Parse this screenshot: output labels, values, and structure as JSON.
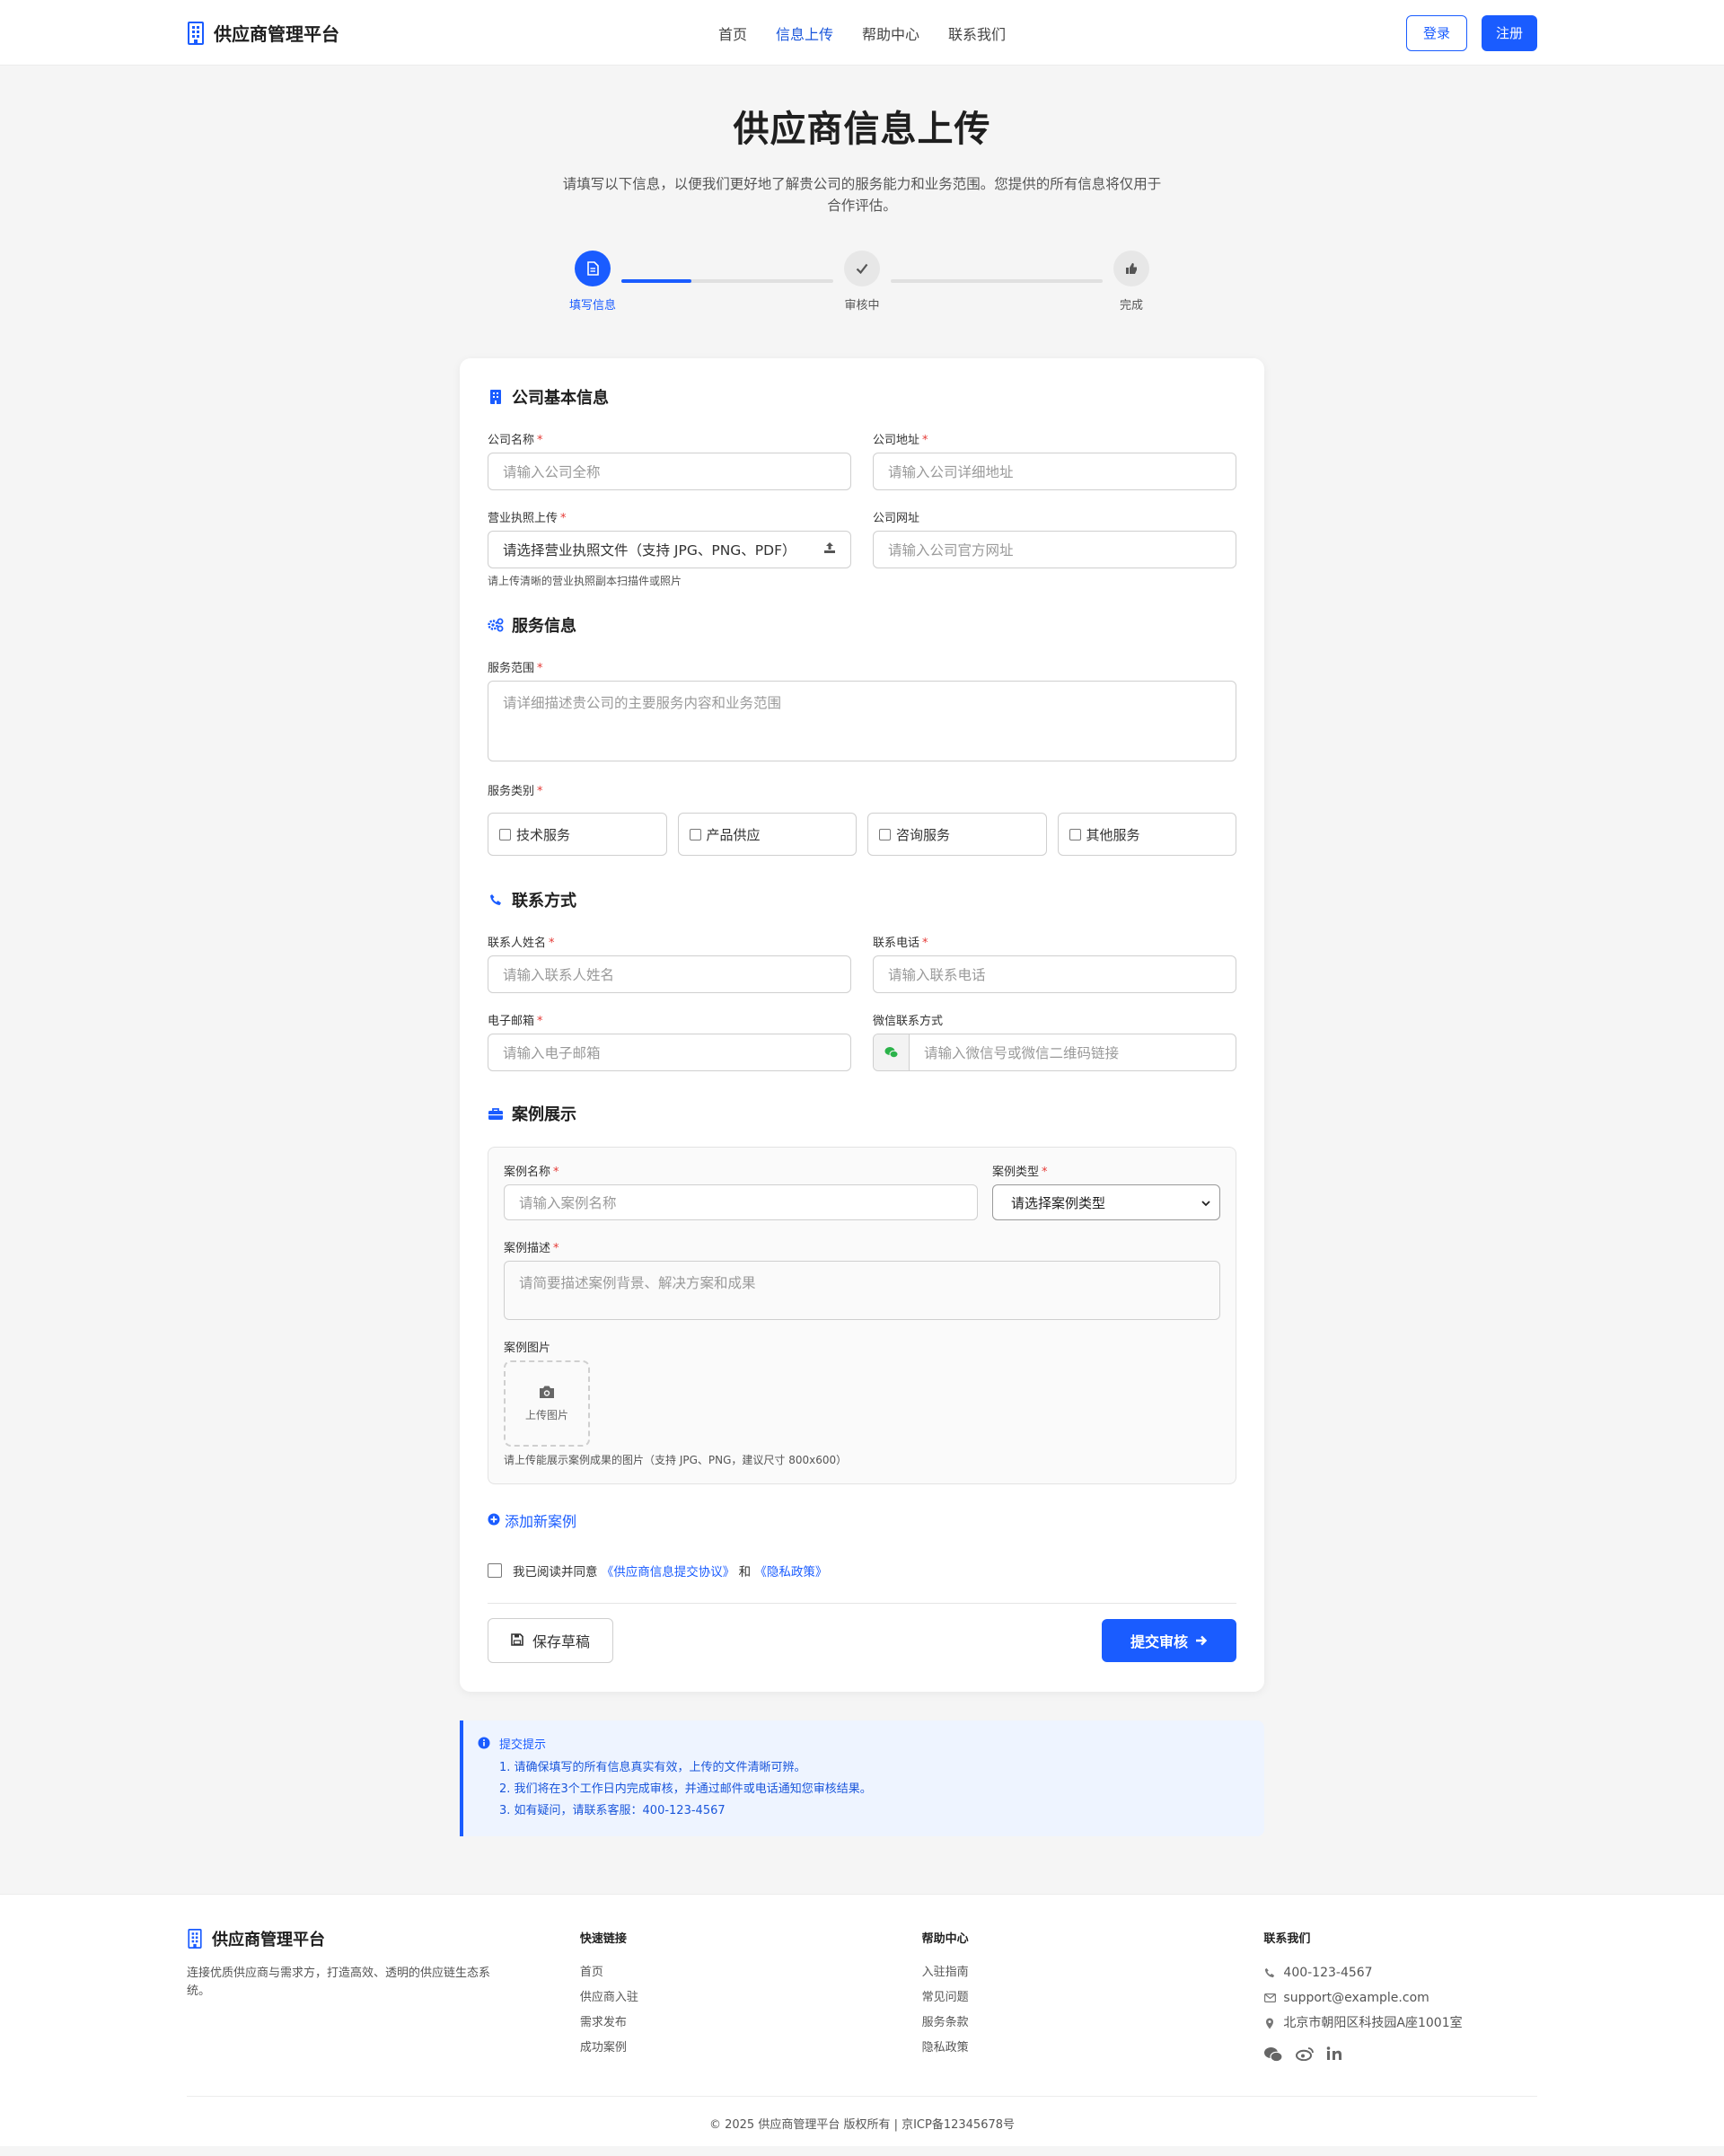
{
  "header": {
    "brand": "供应商管理平台",
    "nav": [
      "首页",
      "信息上传",
      "帮助中心",
      "联系我们"
    ],
    "nav_active_index": 1,
    "login_label": "登录",
    "register_label": "注册"
  },
  "hero": {
    "title": "供应商信息上传",
    "description": "请填写以下信息，以便我们更好地了解贵公司的服务能力和业务范围。您提供的所有信息将仅用于合作评估。"
  },
  "steps": {
    "items": [
      {
        "label": "填写信息",
        "icon": "document-icon",
        "state": "active"
      },
      {
        "label": "审核中",
        "icon": "check-icon",
        "state": "pending"
      },
      {
        "label": "完成",
        "icon": "thumbs-up-icon",
        "state": "pending"
      }
    ],
    "progress_first_segment": 0.33
  },
  "sections": {
    "basic": "公司基本信息",
    "service": "服务信息",
    "contact": "联系方式",
    "cases": "案例展示"
  },
  "basic_fields": {
    "company_name": {
      "label": "公司名称",
      "placeholder": "请输入公司全称",
      "required": "*"
    },
    "company_address": {
      "label": "公司地址",
      "placeholder": "请输入公司详细地址",
      "required": "*"
    },
    "license": {
      "label": "营业执照上传",
      "placeholder": "请选择营业执照文件（支持 JPG、PNG、PDF）",
      "required": "*",
      "help": "请上传清晰的营业执照副本扫描件或照片"
    },
    "website": {
      "label": "公司网址",
      "placeholder": "请输入公司官方网址"
    }
  },
  "service_fields": {
    "scope": {
      "label": "服务范围",
      "placeholder": "请详细描述贵公司的主要服务内容和业务范围",
      "required": "*"
    },
    "category": {
      "label": "服务类别",
      "required": "*",
      "options": [
        "技术服务",
        "产品供应",
        "咨询服务",
        "其他服务"
      ]
    }
  },
  "contact_fields": {
    "contact_name": {
      "label": "联系人姓名",
      "placeholder": "请输入联系人姓名",
      "required": "*"
    },
    "phone": {
      "label": "联系电话",
      "placeholder": "请输入联系电话",
      "required": "*"
    },
    "email": {
      "label": "电子邮箱",
      "placeholder": "请输入电子邮箱",
      "required": "*"
    },
    "wechat": {
      "label": "微信联系方式",
      "placeholder": "请输入微信号或微信二维码链接"
    }
  },
  "case_fields": {
    "name": {
      "label": "案例名称",
      "placeholder": "请输入案例名称",
      "required": "*"
    },
    "type": {
      "label": "案例类型",
      "value": "请选择案例类型",
      "required": "*"
    },
    "description": {
      "label": "案例描述",
      "placeholder": "请简要描述案例背景、解决方案和成果",
      "required": "*"
    },
    "image": {
      "label": "案例图片",
      "upload_label": "上传图片",
      "help": "请上传能展示案例成果的图片（支持 JPG、PNG，建议尺寸 800x600）"
    },
    "add_label": "添加新案例"
  },
  "agreement": {
    "prefix": "我已阅读并同意",
    "link1": "《供应商信息提交协议》",
    "middle": "和",
    "link2": "《隐私政策》"
  },
  "actions": {
    "draft_label": "保存草稿",
    "submit_label": "提交审核"
  },
  "tips": {
    "title": "提交提示",
    "items": [
      "1. 请确保填写的所有信息真实有效，上传的文件清晰可辨。",
      "2. 我们将在3个工作日内完成审核，并通过邮件或电话通知您审核结果。",
      "3. 如有疑问，请联系客服：400-123-4567"
    ]
  },
  "footer": {
    "brand": "供应商管理平台",
    "description": "连接优质供应商与需求方，打造高效、透明的供应链生态系统。",
    "quick_links": {
      "title": "快速链接",
      "items": [
        "首页",
        "供应商入驻",
        "需求发布",
        "成功案例"
      ]
    },
    "help": {
      "title": "帮助中心",
      "items": [
        "入驻指南",
        "常见问题",
        "服务条款",
        "隐私政策"
      ]
    },
    "contact": {
      "title": "联系我们",
      "phone": "400-123-4567",
      "email": "support@example.com",
      "address": "北京市朝阳区科技园A座1001室"
    },
    "social_icons": [
      "wechat-icon",
      "weibo-icon",
      "linkedin-icon"
    ],
    "copyright": "© 2025 供应商管理平台 版权所有 | 京ICP备12345678号"
  },
  "colors": {
    "primary": "#1a5cff",
    "required": "#e53935",
    "tips_bg": "#eef4ff",
    "page_bg": "#f5f5f5"
  }
}
